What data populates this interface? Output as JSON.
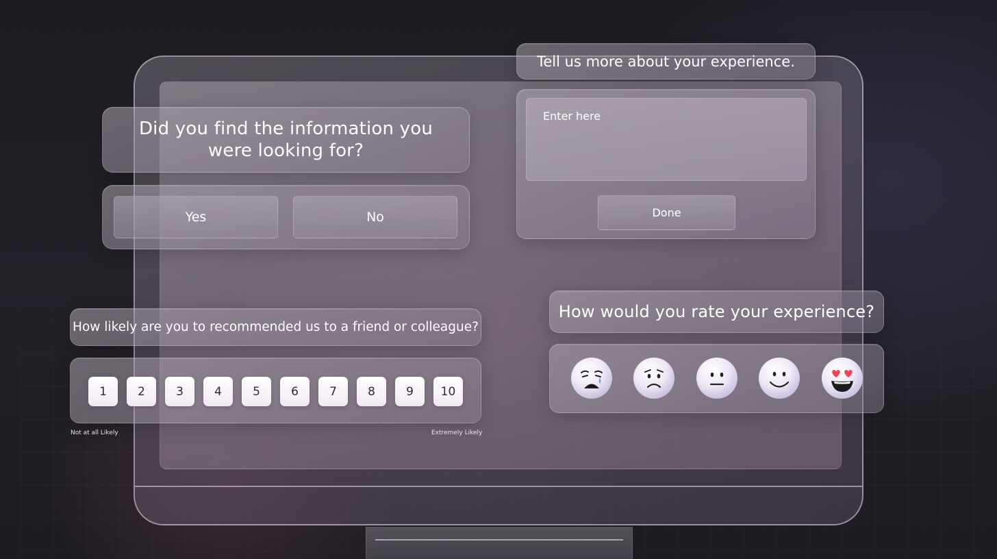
{
  "question_1": {
    "title": "Did you find the information you were looking for?",
    "options": [
      "Yes",
      "No"
    ]
  },
  "question_2": {
    "title": "Tell us more about your experience.",
    "textarea_placeholder": "Enter here",
    "submit_label": "Done"
  },
  "question_3": {
    "title": "How likely are you to recommended us to a friend or colleague?",
    "scale": [
      "1",
      "2",
      "3",
      "4",
      "5",
      "6",
      "7",
      "8",
      "9",
      "10"
    ],
    "low_label": "Not at all Likely",
    "high_label": "Extremely Likely"
  },
  "question_4": {
    "title": "How would you rate your experience?",
    "faces": [
      "crying-face-icon",
      "sad-face-icon",
      "neutral-face-icon",
      "smiling-face-icon",
      "heart-eyes-face-icon"
    ]
  },
  "colors": {
    "background": "#1f1d24",
    "panel_text": "#ffffff",
    "number_button_bg": "#ffffff",
    "heart": "#e8455a"
  }
}
